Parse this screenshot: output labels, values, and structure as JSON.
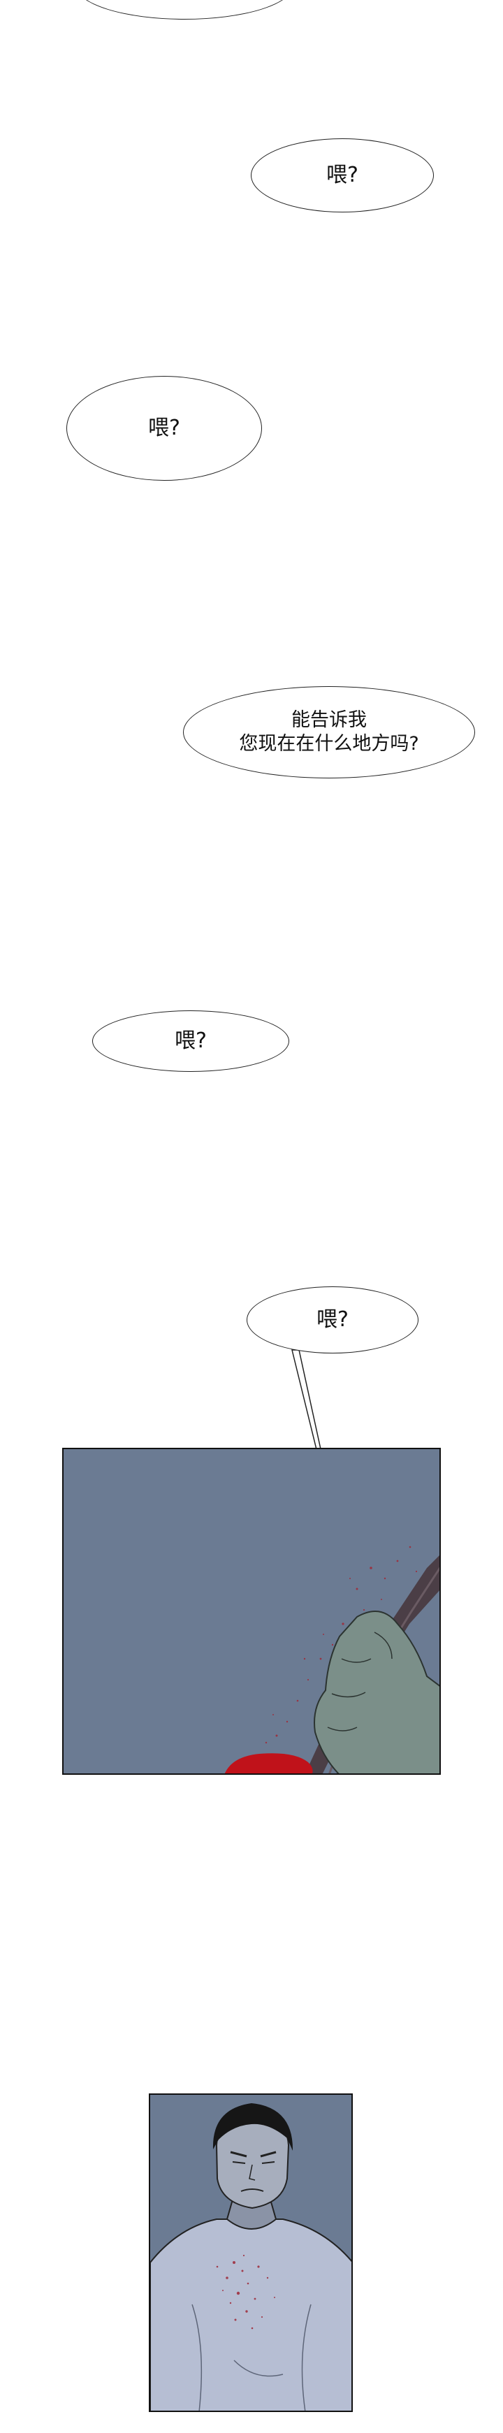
{
  "bubbles": [
    {
      "text": ""
    },
    {
      "text": "喂?"
    },
    {
      "text": "喂?"
    },
    {
      "line1": "能告诉我",
      "line2": "您现在在什么地方吗?"
    },
    {
      "text": "喂?"
    },
    {
      "text": "喂?"
    }
  ],
  "colors": {
    "panel_bg": "#6b7b93",
    "hand": "#7b8f89",
    "blood": "#c0121a",
    "rope": "#4a3d44",
    "shirt": "#b6bed3"
  }
}
